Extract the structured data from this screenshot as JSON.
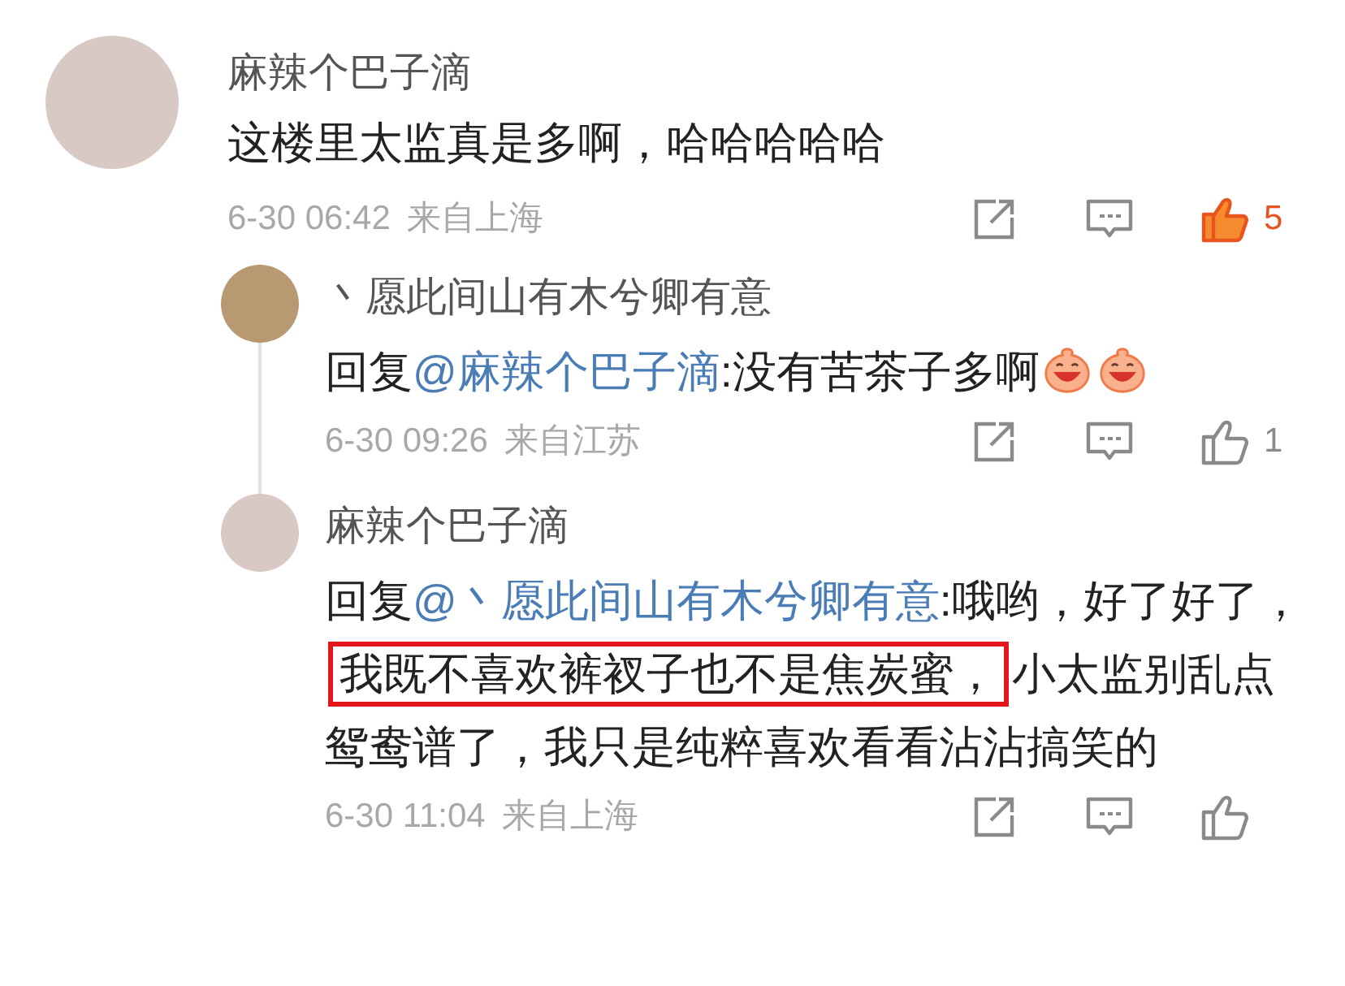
{
  "comment": {
    "name": "麻辣个巴子滴",
    "parts": [
      {
        "kind": "text",
        "text": "这楼里太监真是多啊，哈哈哈哈哈"
      }
    ],
    "time": "6-30 06:42",
    "location": "来自上海",
    "likes": "5",
    "liked": true,
    "replies": [
      {
        "name": "丶愿此间山有木兮卿有意",
        "parts": [
          {
            "kind": "text",
            "text": "回复"
          },
          {
            "kind": "mention",
            "text": "@麻辣个巴子滴"
          },
          {
            "kind": "text",
            "text": ":没有苦茶子多啊"
          },
          {
            "kind": "emoji"
          },
          {
            "kind": "emoji"
          }
        ],
        "time": "6-30 09:26",
        "location": "来自江苏",
        "likes": "1",
        "liked": false
      },
      {
        "name": "麻辣个巴子滴",
        "parts": [
          {
            "kind": "text",
            "text": "回复"
          },
          {
            "kind": "mention",
            "text": "@丶愿此间山有木兮卿有意"
          },
          {
            "kind": "text",
            "text": ":哦哟，好了好了，"
          },
          {
            "kind": "highlight",
            "text": "我既不喜欢裤衩子也不是焦炭蜜，"
          },
          {
            "kind": "text",
            "text": "小太监别乱点鸳鸯谱了，我只是纯粹喜欢看看沾沾搞笑的"
          }
        ],
        "time": "6-30 11:04",
        "location": "来自上海",
        "liked": false
      }
    ]
  }
}
